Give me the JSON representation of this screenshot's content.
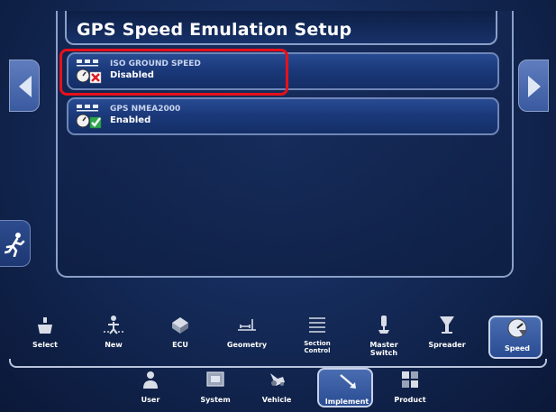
{
  "title": "GPS Speed Emulation Setup",
  "rows": [
    {
      "label": "ISO GROUND SPEED",
      "status": "Disabled",
      "status_icon": "x-icon",
      "status_color": "#e01b24"
    },
    {
      "label": "GPS NMEA2000",
      "status": "Enabled",
      "status_icon": "check-icon",
      "status_color": "#2fa84f"
    }
  ],
  "toolbar": {
    "items": [
      {
        "label": "Select",
        "icon": "select-icon"
      },
      {
        "label": "New",
        "icon": "new-icon"
      },
      {
        "label": "ECU",
        "icon": "ecu-icon"
      },
      {
        "label": "Geometry",
        "icon": "geometry-icon"
      },
      {
        "label": "Section Control",
        "icon": "section-control-icon"
      },
      {
        "label": "Master Switch",
        "icon": "master-switch-icon"
      },
      {
        "label": "Spreader",
        "icon": "spreader-icon"
      },
      {
        "label": "Speed",
        "icon": "speed-icon",
        "selected": true
      }
    ]
  },
  "nav": {
    "items": [
      {
        "label": "User",
        "icon": "user-icon"
      },
      {
        "label": "System",
        "icon": "system-icon"
      },
      {
        "label": "Vehicle",
        "icon": "vehicle-icon"
      },
      {
        "label": "Implement",
        "icon": "implement-icon",
        "selected": true
      },
      {
        "label": "Product",
        "icon": "product-icon"
      }
    ]
  },
  "colors": {
    "background": "#142a58",
    "panel_border": "#8aa0c8",
    "highlight": "#e8101a",
    "selected_fill": "#3a5ca2"
  }
}
